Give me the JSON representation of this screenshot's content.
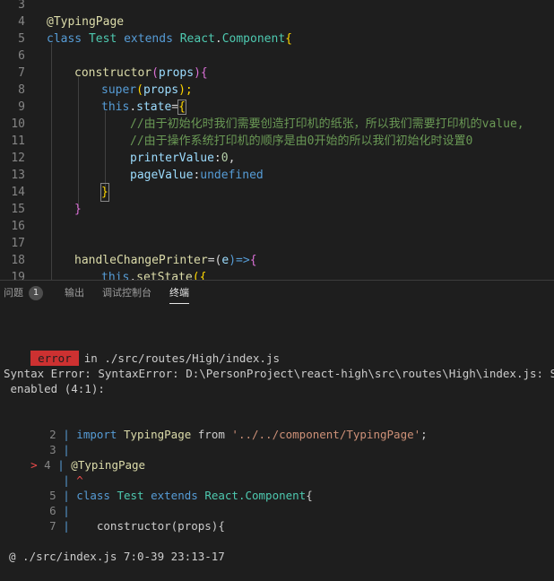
{
  "editor": {
    "lines": [
      {
        "n": "3"
      },
      {
        "n": "4",
        "decorator": "@TypingPage"
      },
      {
        "n": "5",
        "kw1": "class",
        "cls1": "Test",
        "kw2": "extends",
        "cls2": "React",
        "dot": ".",
        "cls3": "Component",
        "brace": "{"
      },
      {
        "n": "6"
      },
      {
        "n": "7",
        "fn": "constructor",
        "open": "(",
        "param": "props",
        "close": ")",
        "brace": "{"
      },
      {
        "n": "8",
        "fn": "super",
        "open": "(",
        "param": "props",
        "close": ");"
      },
      {
        "n": "9",
        "kw": "this",
        "dot": ".",
        "prop": "state",
        "eq": "=",
        "brace": "{"
      },
      {
        "n": "10",
        "comment": "//由于初始化时我们需要创造打印机的纸张，所以我们需要打印机的value,"
      },
      {
        "n": "11",
        "comment": "//由于操作系统打印机的顺序是由0开始的所以我们初始化时设置0"
      },
      {
        "n": "12",
        "prop": "printerValue",
        "colon": ":",
        "num": "0",
        "comma": ","
      },
      {
        "n": "13",
        "prop": "pageValue",
        "colon": ":",
        "kw": "undefined"
      },
      {
        "n": "14",
        "brace": "}"
      },
      {
        "n": "15",
        "brace": "}"
      },
      {
        "n": "16"
      },
      {
        "n": "17"
      },
      {
        "n": "18",
        "fn": "handleChangePrinter",
        "eq": "=(",
        "param": "e",
        "arrow": ")=>",
        "brace": "{"
      },
      {
        "n": "19",
        "kw": "this",
        "dot": ".",
        "fn": "setState",
        "open": "({"
      }
    ]
  },
  "panel": {
    "tabs": [
      {
        "label": "问题",
        "badge": "1"
      },
      {
        "label": "输出"
      },
      {
        "label": "调试控制台"
      },
      {
        "label": "终端"
      }
    ]
  },
  "terminal": {
    "error_tag": "error",
    "error_path": "in ./src/routes/High/index.js",
    "syntax_line1": "Syntax Error: SyntaxError: D:\\PersonProject\\react-high\\src\\routes\\High\\index.js: Support for the experimental syntax 'decorators-legacy' isn't currently",
    "syntax_line2": " enabled (4:1):",
    "snippet": [
      {
        "n": "2",
        "kw": "import",
        "name": "TypingPage",
        "from": "from",
        "str": "'../../component/TypingPage'",
        "end": ";"
      },
      {
        "n": "3"
      },
      {
        "n": "4",
        "pointer": ">",
        "deco": "@TypingPage"
      },
      {
        "caret": "^"
      },
      {
        "n": "5",
        "kw1": "class",
        "cls": "Test",
        "kw2": "extends",
        "cls2": "React.Component",
        "brace": "{"
      },
      {
        "n": "6"
      },
      {
        "n": "7",
        "text": "constructor(props){"
      }
    ],
    "footer": "@ ./src/index.js 7:0-39 23:13-17"
  }
}
